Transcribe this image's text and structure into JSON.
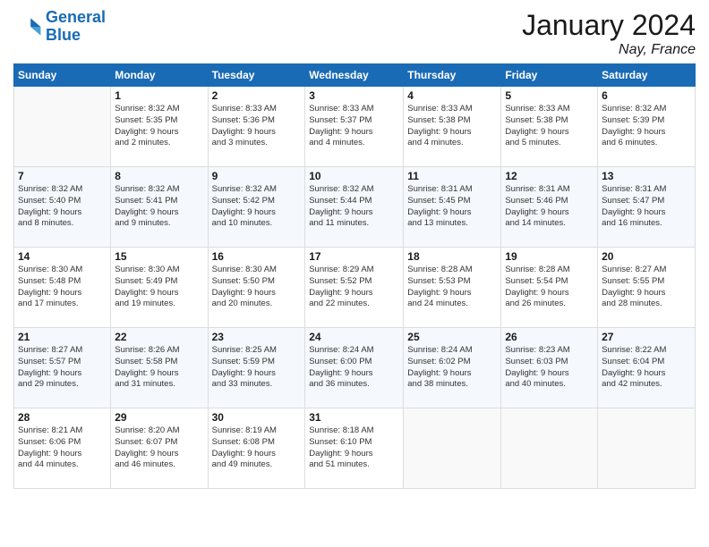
{
  "header": {
    "logo_line1": "General",
    "logo_line2": "Blue",
    "month": "January 2024",
    "location": "Nay, France"
  },
  "days_of_week": [
    "Sunday",
    "Monday",
    "Tuesday",
    "Wednesday",
    "Thursday",
    "Friday",
    "Saturday"
  ],
  "weeks": [
    [
      {
        "num": "",
        "info": ""
      },
      {
        "num": "1",
        "info": "Sunrise: 8:32 AM\nSunset: 5:35 PM\nDaylight: 9 hours\nand 2 minutes."
      },
      {
        "num": "2",
        "info": "Sunrise: 8:33 AM\nSunset: 5:36 PM\nDaylight: 9 hours\nand 3 minutes."
      },
      {
        "num": "3",
        "info": "Sunrise: 8:33 AM\nSunset: 5:37 PM\nDaylight: 9 hours\nand 4 minutes."
      },
      {
        "num": "4",
        "info": "Sunrise: 8:33 AM\nSunset: 5:38 PM\nDaylight: 9 hours\nand 4 minutes."
      },
      {
        "num": "5",
        "info": "Sunrise: 8:33 AM\nSunset: 5:38 PM\nDaylight: 9 hours\nand 5 minutes."
      },
      {
        "num": "6",
        "info": "Sunrise: 8:32 AM\nSunset: 5:39 PM\nDaylight: 9 hours\nand 6 minutes."
      }
    ],
    [
      {
        "num": "7",
        "info": "Sunrise: 8:32 AM\nSunset: 5:40 PM\nDaylight: 9 hours\nand 8 minutes."
      },
      {
        "num": "8",
        "info": "Sunrise: 8:32 AM\nSunset: 5:41 PM\nDaylight: 9 hours\nand 9 minutes."
      },
      {
        "num": "9",
        "info": "Sunrise: 8:32 AM\nSunset: 5:42 PM\nDaylight: 9 hours\nand 10 minutes."
      },
      {
        "num": "10",
        "info": "Sunrise: 8:32 AM\nSunset: 5:44 PM\nDaylight: 9 hours\nand 11 minutes."
      },
      {
        "num": "11",
        "info": "Sunrise: 8:31 AM\nSunset: 5:45 PM\nDaylight: 9 hours\nand 13 minutes."
      },
      {
        "num": "12",
        "info": "Sunrise: 8:31 AM\nSunset: 5:46 PM\nDaylight: 9 hours\nand 14 minutes."
      },
      {
        "num": "13",
        "info": "Sunrise: 8:31 AM\nSunset: 5:47 PM\nDaylight: 9 hours\nand 16 minutes."
      }
    ],
    [
      {
        "num": "14",
        "info": "Sunrise: 8:30 AM\nSunset: 5:48 PM\nDaylight: 9 hours\nand 17 minutes."
      },
      {
        "num": "15",
        "info": "Sunrise: 8:30 AM\nSunset: 5:49 PM\nDaylight: 9 hours\nand 19 minutes."
      },
      {
        "num": "16",
        "info": "Sunrise: 8:30 AM\nSunset: 5:50 PM\nDaylight: 9 hours\nand 20 minutes."
      },
      {
        "num": "17",
        "info": "Sunrise: 8:29 AM\nSunset: 5:52 PM\nDaylight: 9 hours\nand 22 minutes."
      },
      {
        "num": "18",
        "info": "Sunrise: 8:28 AM\nSunset: 5:53 PM\nDaylight: 9 hours\nand 24 minutes."
      },
      {
        "num": "19",
        "info": "Sunrise: 8:28 AM\nSunset: 5:54 PM\nDaylight: 9 hours\nand 26 minutes."
      },
      {
        "num": "20",
        "info": "Sunrise: 8:27 AM\nSunset: 5:55 PM\nDaylight: 9 hours\nand 28 minutes."
      }
    ],
    [
      {
        "num": "21",
        "info": "Sunrise: 8:27 AM\nSunset: 5:57 PM\nDaylight: 9 hours\nand 29 minutes."
      },
      {
        "num": "22",
        "info": "Sunrise: 8:26 AM\nSunset: 5:58 PM\nDaylight: 9 hours\nand 31 minutes."
      },
      {
        "num": "23",
        "info": "Sunrise: 8:25 AM\nSunset: 5:59 PM\nDaylight: 9 hours\nand 33 minutes."
      },
      {
        "num": "24",
        "info": "Sunrise: 8:24 AM\nSunset: 6:00 PM\nDaylight: 9 hours\nand 36 minutes."
      },
      {
        "num": "25",
        "info": "Sunrise: 8:24 AM\nSunset: 6:02 PM\nDaylight: 9 hours\nand 38 minutes."
      },
      {
        "num": "26",
        "info": "Sunrise: 8:23 AM\nSunset: 6:03 PM\nDaylight: 9 hours\nand 40 minutes."
      },
      {
        "num": "27",
        "info": "Sunrise: 8:22 AM\nSunset: 6:04 PM\nDaylight: 9 hours\nand 42 minutes."
      }
    ],
    [
      {
        "num": "28",
        "info": "Sunrise: 8:21 AM\nSunset: 6:06 PM\nDaylight: 9 hours\nand 44 minutes."
      },
      {
        "num": "29",
        "info": "Sunrise: 8:20 AM\nSunset: 6:07 PM\nDaylight: 9 hours\nand 46 minutes."
      },
      {
        "num": "30",
        "info": "Sunrise: 8:19 AM\nSunset: 6:08 PM\nDaylight: 9 hours\nand 49 minutes."
      },
      {
        "num": "31",
        "info": "Sunrise: 8:18 AM\nSunset: 6:10 PM\nDaylight: 9 hours\nand 51 minutes."
      },
      {
        "num": "",
        "info": ""
      },
      {
        "num": "",
        "info": ""
      },
      {
        "num": "",
        "info": ""
      }
    ]
  ]
}
